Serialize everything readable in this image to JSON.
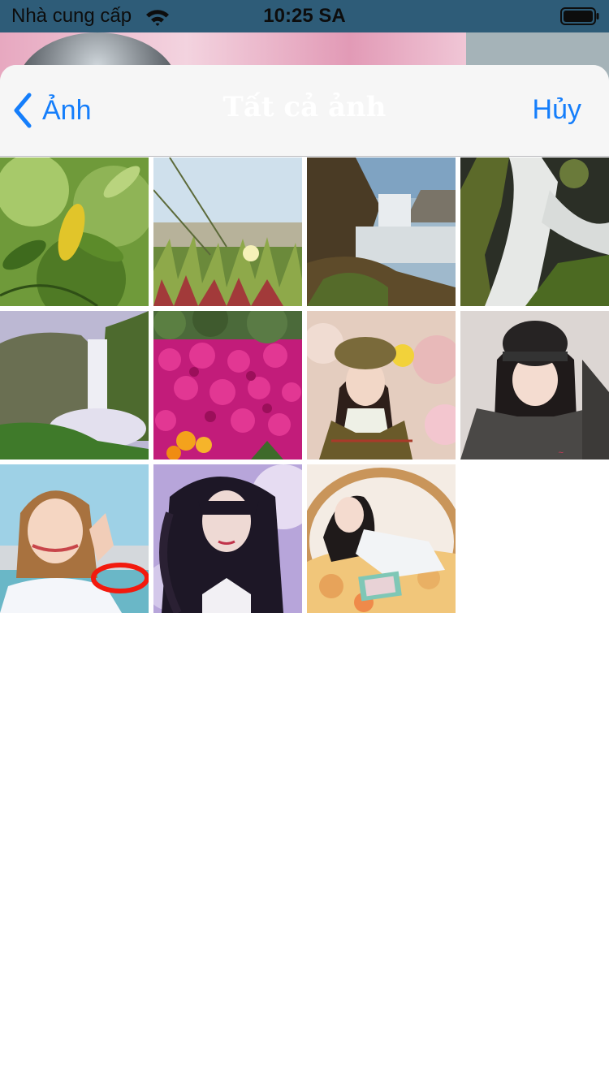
{
  "status_bar": {
    "carrier": "Nhà cung cấp",
    "time": "10:25 SA",
    "wifi_icon": "wifi-icon",
    "battery_icon": "battery-icon"
  },
  "nav": {
    "back_label": "Ảnh",
    "back_icon": "chevron-left-icon",
    "title": "Tất cả ảnh",
    "cancel_label": "Hủy",
    "accent_color": "#157efb"
  },
  "photos": [
    {
      "subject": "green leaves"
    },
    {
      "subject": "coastal dune flowers"
    },
    {
      "subject": "waterfall at sea"
    },
    {
      "subject": "long-exposure waterfall"
    },
    {
      "subject": "misty cliff waterfall"
    },
    {
      "subject": "pink flower bed"
    },
    {
      "subject": "girl in beret"
    },
    {
      "subject": "girl in beanie"
    },
    {
      "subject": "smiling girl by the sea"
    },
    {
      "subject": "girl with windblown hair"
    },
    {
      "subject": "girl in wicker chair"
    }
  ]
}
